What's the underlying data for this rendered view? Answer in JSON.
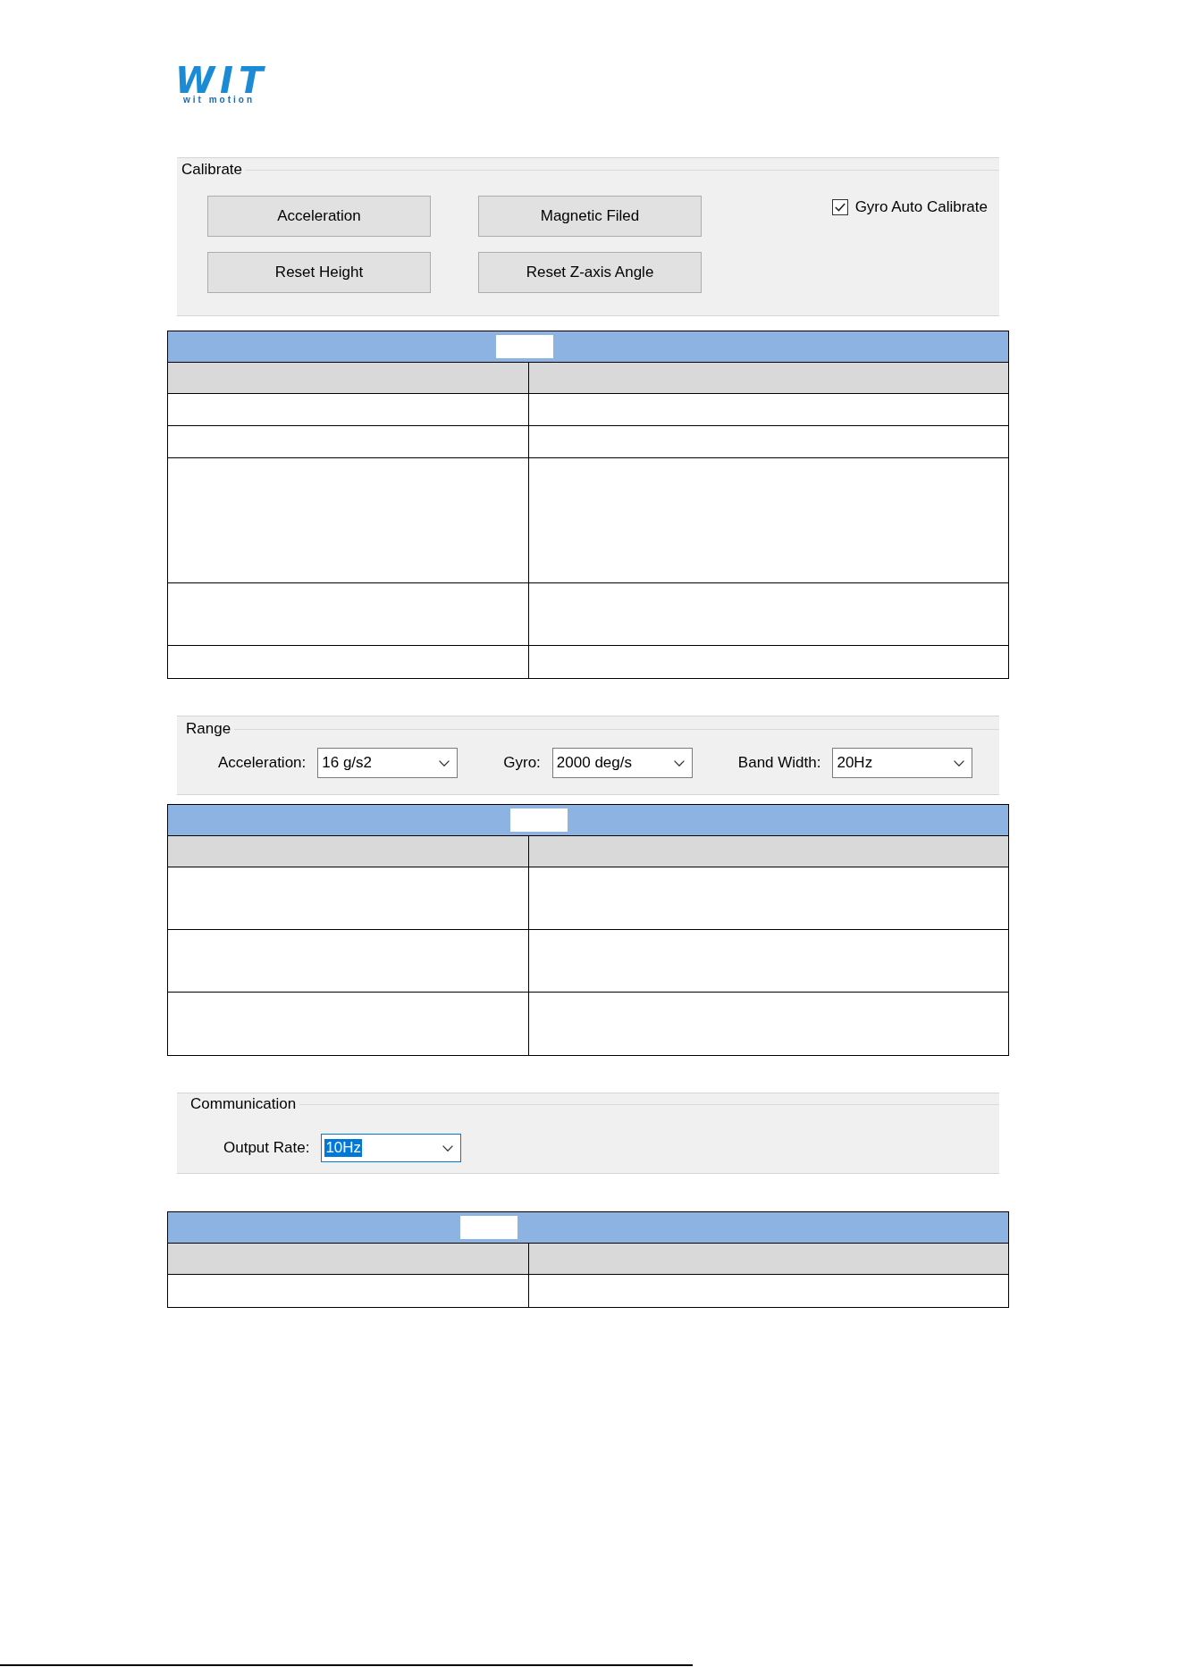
{
  "logo": {
    "wordmark": "WIT",
    "tagline": "wit motion"
  },
  "sections": [
    {
      "kind": "group",
      "title": "Calibrate",
      "buttons": [
        "Acceleration",
        "Magnetic Filed",
        "Reset Height",
        "Reset Z-axis Angle"
      ],
      "checkbox": {
        "label": "Gyro Auto Calibrate",
        "checked": true
      }
    },
    {
      "kind": "table",
      "rows": [
        {
          "kind": "single"
        },
        {
          "kind": "single"
        },
        {
          "kind": "quad"
        },
        {
          "kind": "double"
        },
        {
          "kind": "single"
        }
      ]
    },
    {
      "kind": "group",
      "title": "Range",
      "fields": [
        {
          "label": "Acceleration:",
          "value": "16 g/s2",
          "focused": false
        },
        {
          "label": "Gyro:",
          "value": "2000 deg/s",
          "focused": false
        },
        {
          "label": "Band Width:",
          "value": "20Hz",
          "focused": false
        }
      ]
    },
    {
      "kind": "table",
      "rows": [
        {
          "kind": "double"
        },
        {
          "kind": "double"
        },
        {
          "kind": "double"
        }
      ]
    },
    {
      "kind": "group",
      "title": "Communication",
      "fields": [
        {
          "label": "Output Rate:",
          "value": "10Hz",
          "focused": true
        }
      ]
    },
    {
      "kind": "table",
      "rows": [
        {
          "kind": "single"
        }
      ]
    }
  ]
}
